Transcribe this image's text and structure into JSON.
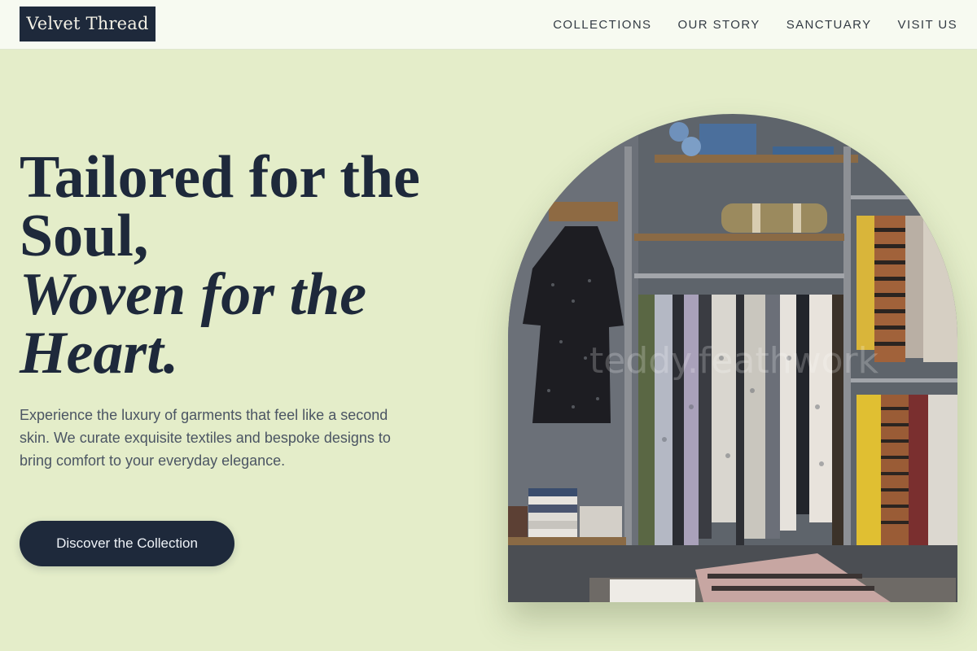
{
  "header": {
    "logo": "Velvet Thread",
    "nav": [
      "COLLECTIONS",
      "OUR STORY",
      "SANCTUARY",
      "VISIT US"
    ]
  },
  "hero": {
    "headline_line1": "Tailored for the",
    "headline_line2": "Soul,",
    "headline_italic1": "Woven for the",
    "headline_italic2": "Heart.",
    "description": "Experience the luxury of garments that feel like a second skin. We curate exquisite textiles and bespoke designs to bring comfort to your everyday elegance.",
    "cta_label": "Discover the Collection",
    "image_watermark": "teddy.feathwork"
  },
  "colors": {
    "background": "#e4edc9",
    "header_bg": "#f7faf1",
    "primary_dark": "#1e293b",
    "body_text": "#4b5563"
  }
}
